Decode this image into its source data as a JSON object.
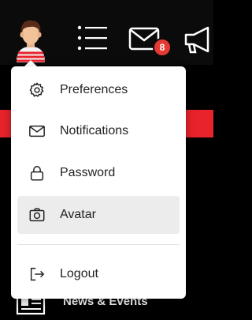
{
  "header": {
    "notification_count": "8",
    "icons": [
      "user-avatar",
      "menu-icon",
      "mail-icon",
      "megaphone-icon"
    ]
  },
  "dropdown": {
    "items": [
      {
        "label": "Preferences",
        "icon": "gear-icon"
      },
      {
        "label": "Notifications",
        "icon": "envelope-icon"
      },
      {
        "label": "Password",
        "icon": "lock-icon"
      },
      {
        "label": "Avatar",
        "icon": "camera-icon"
      },
      {
        "label": "Logout",
        "icon": "logout-icon"
      }
    ]
  },
  "background_nav": {
    "label": "News & Events"
  },
  "colors": {
    "accent_red": "#e8232c",
    "badge_red": "#e53a34",
    "active_item_bg": "#ececec"
  }
}
